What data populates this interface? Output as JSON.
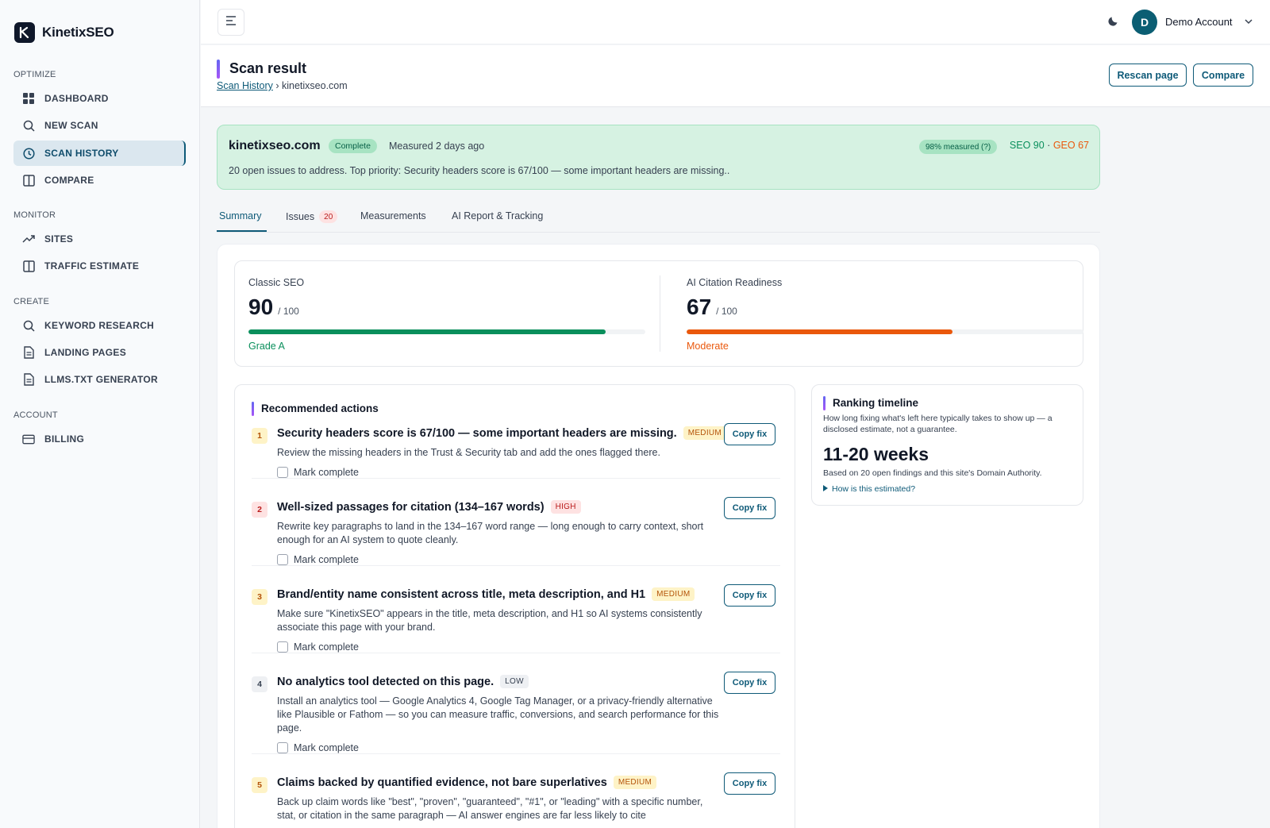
{
  "app": {
    "name": "KinetixSEO"
  },
  "sidebar": {
    "sections": [
      {
        "label": "OPTIMIZE",
        "items": [
          {
            "label": "DASHBOARD",
            "icon": "grid-icon"
          },
          {
            "label": "NEW SCAN",
            "icon": "search-icon"
          },
          {
            "label": "SCAN HISTORY",
            "icon": "clock-icon",
            "active": true
          },
          {
            "label": "COMPARE",
            "icon": "columns-icon"
          }
        ]
      },
      {
        "label": "MONITOR",
        "items": [
          {
            "label": "SITES",
            "icon": "trend-icon"
          },
          {
            "label": "TRAFFIC ESTIMATE",
            "icon": "columns-icon"
          }
        ]
      },
      {
        "label": "CREATE",
        "items": [
          {
            "label": "KEYWORD RESEARCH",
            "icon": "search-icon"
          },
          {
            "label": "LANDING PAGES",
            "icon": "document-icon"
          },
          {
            "label": "LLMS.TXT GENERATOR",
            "icon": "document-icon"
          }
        ]
      },
      {
        "label": "ACCOUNT",
        "items": [
          {
            "label": "BILLING",
            "icon": "card-icon"
          }
        ]
      }
    ]
  },
  "topbar": {
    "avatar_initial": "D",
    "account_name": "Demo Account"
  },
  "header": {
    "title": "Scan result",
    "breadcrumb_link": "Scan History",
    "breadcrumb_sep": "›",
    "breadcrumb_current": "kinetixseo.com",
    "rescan_label": "Rescan page",
    "compare_label": "Compare"
  },
  "banner": {
    "domain": "kinetixseo.com",
    "status": "Complete",
    "measured": "Measured 2 days ago",
    "coverage": "98% measured (?)",
    "seo_score": "SEO 90",
    "dot": "·",
    "geo_score": "GEO 67",
    "summary": "20 open issues to address. Top priority: Security headers score is 67/100 — some important headers are missing.."
  },
  "tabs": [
    {
      "label": "Summary",
      "active": true
    },
    {
      "label": "Issues",
      "count": "20"
    },
    {
      "label": "Measurements"
    },
    {
      "label": "AI Report & Tracking"
    }
  ],
  "scores": {
    "seo": {
      "label": "Classic SEO",
      "value": "90",
      "max": "/ 100",
      "fraction": 0.9,
      "grade": "Grade A",
      "color": "#0a8f5c"
    },
    "ai": {
      "label": "AI Citation Readiness",
      "value": "67",
      "max": "/ 100",
      "fraction": 0.67,
      "grade": "Moderate",
      "color": "#ea580c"
    }
  },
  "actions": {
    "title": "Recommended actions",
    "mark_label": "Mark complete",
    "copy_label": "Copy fix",
    "items": [
      {
        "num": "1",
        "title": "Security headers score is 67/100 — some important headers are missing.",
        "severity": "MEDIUM",
        "desc": "Review the missing headers in the Trust & Security tab and add the ones flagged there."
      },
      {
        "num": "2",
        "title": "Well-sized passages for citation (134–167 words)",
        "severity": "HIGH",
        "desc": "Rewrite key paragraphs to land in the 134–167 word range — long enough to carry context, short enough for an AI system to quote cleanly."
      },
      {
        "num": "3",
        "title": "Brand/entity name consistent across title, meta description, and H1",
        "severity": "MEDIUM",
        "desc": "Make sure \"KinetixSEO\" appears in the title, meta description, and H1 so AI systems consistently associate this page with your brand."
      },
      {
        "num": "4",
        "title": "No analytics tool detected on this page.",
        "severity": "LOW",
        "desc": "Install an analytics tool — Google Analytics 4, Google Tag Manager, or a privacy-friendly alternative like Plausible or Fathom — so you can measure traffic, conversions, and search performance for this page."
      },
      {
        "num": "5",
        "title": "Claims backed by quantified evidence, not bare superlatives",
        "severity": "MEDIUM",
        "desc": "Back up claim words like \"best\", \"proven\", \"guaranteed\", \"#1\", or \"leading\" with a specific number, stat, or citation in the same paragraph — AI answer engines are far less likely to cite"
      }
    ]
  },
  "timeline": {
    "title": "Ranking timeline",
    "subtitle": "How long fixing what's left here typically takes to show up — a disclosed estimate, not a guarantee.",
    "value": "11-20 weeks",
    "basis": "Based on 20 open findings and this site's Domain Authority.",
    "link": "How is this estimated?"
  }
}
